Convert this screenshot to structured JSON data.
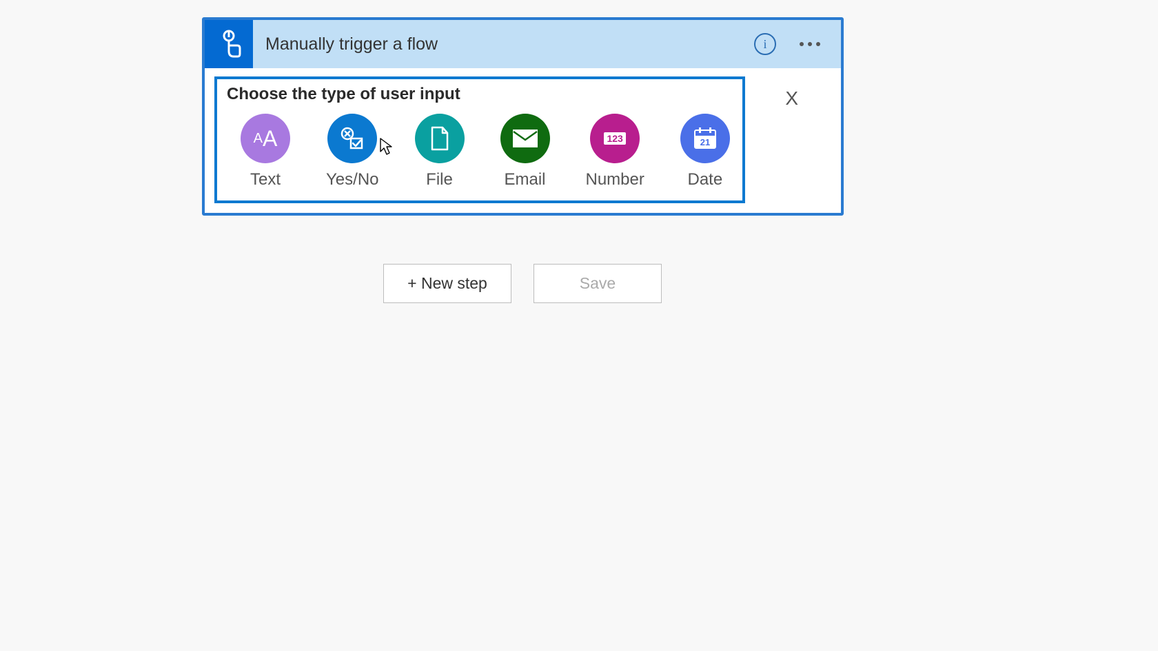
{
  "card": {
    "title": "Manually trigger a flow"
  },
  "inputTypes": {
    "heading": "Choose the type of user input",
    "close": "X",
    "options": [
      {
        "label": "Text",
        "iconSmall": "A",
        "iconBig": "A"
      },
      {
        "label": "Yes/No"
      },
      {
        "label": "File"
      },
      {
        "label": "Email"
      },
      {
        "label": "Number",
        "iconText": "123"
      },
      {
        "label": "Date",
        "iconText": "21"
      }
    ]
  },
  "buttons": {
    "newStep": "+ New step",
    "save": "Save"
  }
}
